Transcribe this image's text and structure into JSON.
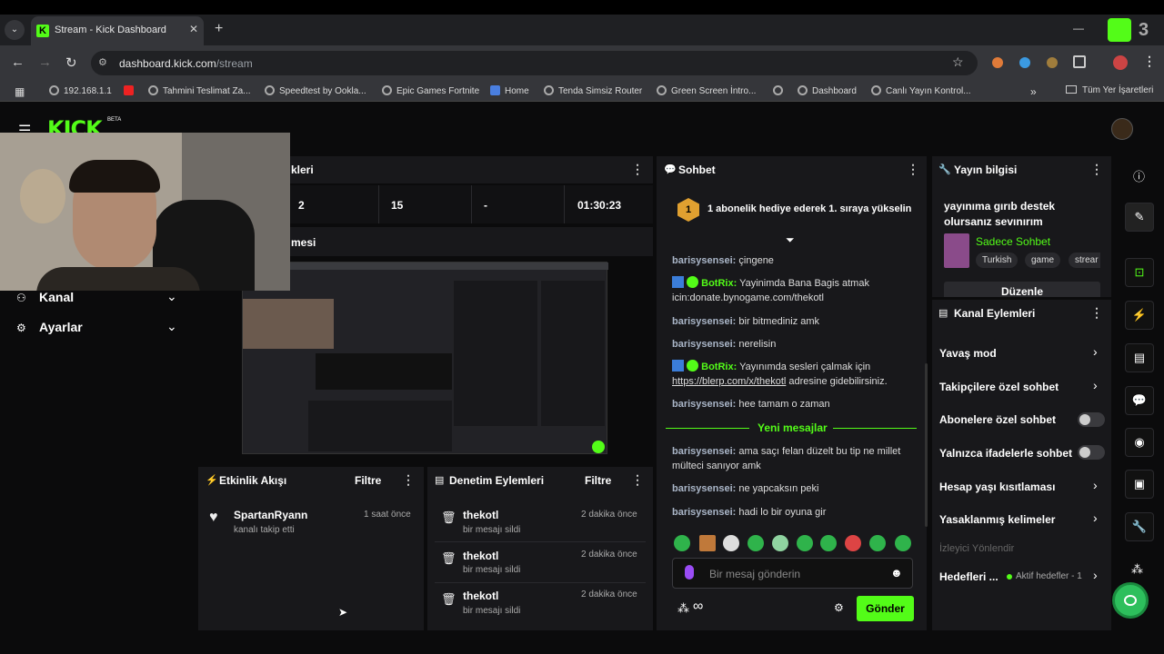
{
  "browser": {
    "tab_title": "Stream - Kick Dashboard",
    "url_host": "dashboard.kick.com",
    "url_path": "/stream",
    "bookmarks": [
      "192.168.1.1",
      "Tahmini Teslimat Za...",
      "Speedtest by Ookla...",
      "Epic Games Fortnite",
      "Home",
      "Tenda Simsiz Router",
      "Green Screen İntro...",
      "Dashboard",
      "Canlı Yayın Kontrol...",
      "Tüm Yer İşaretleri"
    ]
  },
  "kick": {
    "logo": "KICK",
    "beta": "BETA"
  },
  "sidebar": {
    "items": [
      {
        "label": "Kanal"
      },
      {
        "label": "Ayarlar"
      }
    ]
  },
  "stats": {
    "title_partial": "kleri",
    "values": [
      "2",
      "15",
      "-",
      "01:30:23"
    ]
  },
  "preview": {
    "title_partial": "mesi"
  },
  "activity": {
    "title": "Etkinlik Akışı",
    "filter": "Filtre",
    "rows": [
      {
        "user": "SpartanRyann",
        "action": "kanalı takip etti",
        "time": "1 saat önce"
      }
    ]
  },
  "moderation": {
    "title": "Denetim Eylemleri",
    "filter": "Filtre",
    "rows": [
      {
        "user": "thekotl",
        "action": "bir mesajı sildi",
        "time": "2 dakika önce"
      },
      {
        "user": "thekotl",
        "action": "bir mesajı sildi",
        "time": "2 dakika önce"
      },
      {
        "user": "thekotl",
        "action": "bir mesajı sildi",
        "time": "2 dakika önce"
      }
    ]
  },
  "chat": {
    "title": "Sohbet",
    "pinned_rank": "1",
    "pinned": "1 abonelik hediye ederek 1. sıraya yükselin",
    "messages": [
      {
        "user": "barisysensei:",
        "text": "çingene"
      },
      {
        "user": "BotRix:",
        "text": "Yayinimda Bana Bagis atmak icin:donate.bynogame.com/thekotl"
      },
      {
        "user": "barisysensei:",
        "text": "bir bitmediniz amk"
      },
      {
        "user": "barisysensei:",
        "text": "nerelisin"
      },
      {
        "user": "BotRix:",
        "text": "Yayınımda sesleri çalmak için",
        "link": "https://blerp.com/x/thekotl",
        "after": "adresine gidebilirsiniz."
      },
      {
        "user": "barisysensei:",
        "text": "hee tamam o zaman"
      },
      {
        "user": "barisysensei:",
        "text": "ama saçı felan düzelt bu tip ne millet mülteci sanıyor amk"
      },
      {
        "user": "barisysensei:",
        "text": "ne yapcaksın peki"
      },
      {
        "user": "barisysensei:",
        "text": "hadi lo bir oyuna gir"
      }
    ],
    "new_messages": "Yeni mesajlar",
    "placeholder": "Bir mesaj gönderin",
    "send": "Gönder",
    "infinity": "∞"
  },
  "info": {
    "title": "Yayın bilgisi",
    "stream_title": "yayınıma gırıb destek olursanız sevınırım",
    "category": "Sadece Sohbet",
    "tags": [
      "Turkish",
      "game",
      "strear"
    ],
    "edit": "Düzenle"
  },
  "actions": {
    "title": "Kanal Eylemleri",
    "items": [
      {
        "label": "Yavaş mod",
        "kind": "chevron"
      },
      {
        "label": "Takipçilere özel sohbet",
        "kind": "chevron"
      },
      {
        "label": "Abonelere özel sohbet",
        "kind": "toggle"
      },
      {
        "label": "Yalnızca ifadelerle sohbet",
        "kind": "toggle"
      },
      {
        "label": "Hesap yaşı kısıtlaması",
        "kind": "chevron"
      },
      {
        "label": "Yasaklanmış kelimeler",
        "kind": "chevron"
      }
    ],
    "section": "İzleyici Yönlendir",
    "goals": "Hedefleri ...",
    "goals_status": "Aktif hedefler - 1"
  },
  "colors": {
    "accent": "#53fc18",
    "panel": "#18181b",
    "bg": "#0b0b0c"
  }
}
